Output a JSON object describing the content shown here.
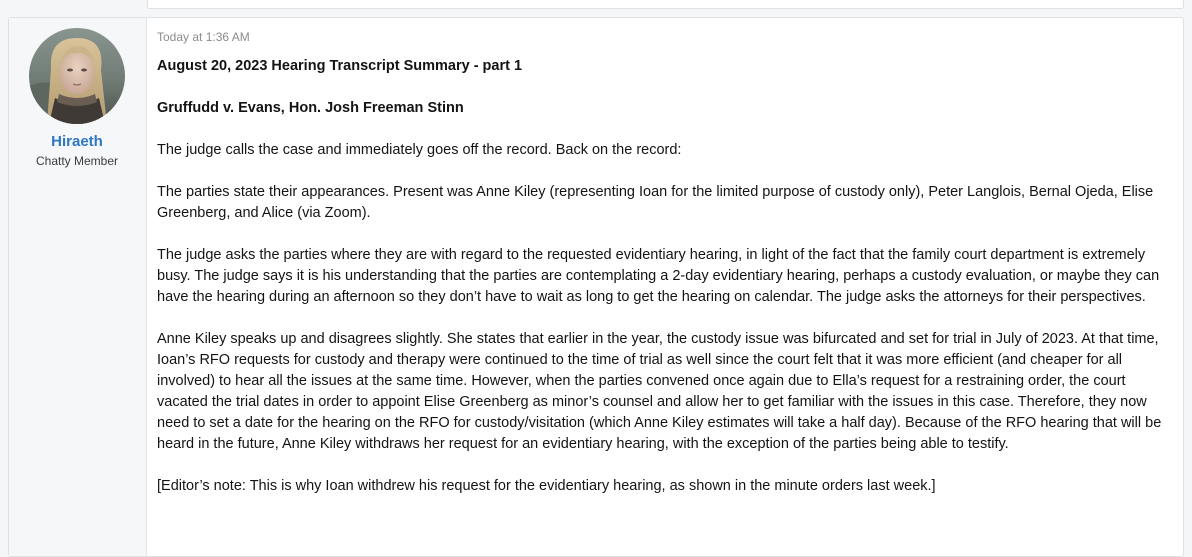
{
  "post": {
    "author": {
      "name": "Hiraeth",
      "title": "Chatty Member"
    },
    "timestamp": "Today at 1:36 AM",
    "paragraphs": [
      "August 20, 2023 Hearing Transcript Summary - part 1",
      "Gruffudd v. Evans, Hon. Josh Freeman Stinn",
      "The judge calls the case and immediately goes off the record. Back on the record:",
      "The parties state their appearances. Present was Anne Kiley (representing Ioan for the limited purpose of custody only), Peter Langlois, Bernal Ojeda, Elise Greenberg, and Alice (via Zoom).",
      "The judge asks the parties where they are with regard to the requested evidentiary hearing, in light of the fact that the family court department is extremely busy. The judge says it is his understanding that the parties are contemplating a 2-day evidentiary hearing, perhaps a custody evaluation, or maybe they can have the hearing during an afternoon so they don’t have to wait as long to get the hearing on calendar. The judge asks the attorneys for their perspectives.",
      "Anne Kiley speaks up and disagrees slightly. She states that earlier in the year, the custody issue was bifurcated and set for trial in July of 2023. At that time, Ioan’s RFO requests for custody and therapy were continued to the time of trial as well since the court felt that it was more efficient (and cheaper for all involved) to hear all the issues at the same time. However, when the parties convened once again due to Ella’s request for a restraining order, the court vacated the trial dates in order to appoint Elise Greenberg as minor’s counsel and allow her to get familiar with the issues in this case. Therefore, they now need to set a date for the hearing on the RFO for custody/visitation (which Anne Kiley estimates will take a half day). Because of the RFO hearing that will be heard in the future, Anne Kiley withdraws her request for an evidentiary hearing, with the exception of the parties being able to testify.",
      "[Editor’s note: This is why Ioan withdrew his request for the evidentiary hearing, as shown in the minute orders last week.]"
    ]
  }
}
